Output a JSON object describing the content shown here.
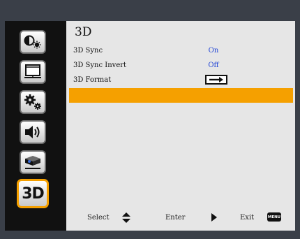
{
  "sidebar": {
    "items": [
      {
        "name": "picture-icon"
      },
      {
        "name": "display-screen-icon"
      },
      {
        "name": "settings-gears-icon"
      },
      {
        "name": "volume-icon"
      },
      {
        "name": "projector-options-icon"
      },
      {
        "name": "3d-icon",
        "label": "3D",
        "active": true
      }
    ]
  },
  "menu": {
    "title": "3D",
    "rows": [
      {
        "label": "3D Sync",
        "value": "On"
      },
      {
        "label": "3D Sync Invert",
        "value": "Off"
      },
      {
        "label": "3D Format",
        "value_icon": "right-arrow-box-icon"
      }
    ]
  },
  "footer": {
    "select_label": "Select",
    "enter_label": "Enter",
    "exit_label": "Exit",
    "menu_key_label": "MENU"
  },
  "colors": {
    "accent": "#f5a000",
    "value_text": "#2447d6",
    "panel_bg": "#e6e6e6",
    "frame": "#111111"
  }
}
